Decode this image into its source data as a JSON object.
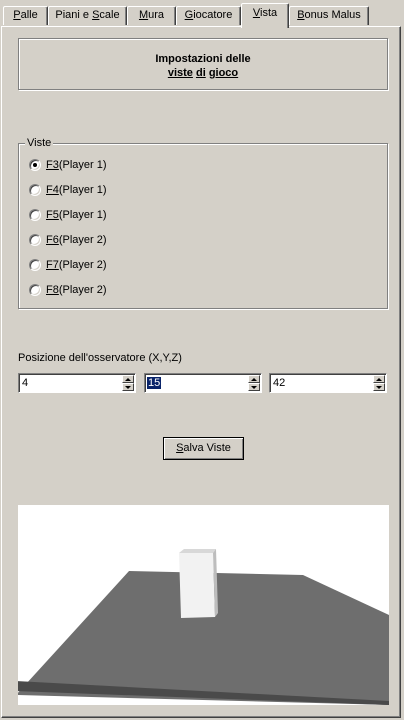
{
  "tabs": [
    {
      "pre": "",
      "key": "P",
      "post": "alle"
    },
    {
      "pre": "Piani e ",
      "key": "S",
      "post": "cale"
    },
    {
      "pre": "",
      "key": "M",
      "post": "ura"
    },
    {
      "pre": "",
      "key": "G",
      "post": "iocatore"
    },
    {
      "pre": "",
      "key": "V",
      "post": "ista"
    },
    {
      "pre": "",
      "key": "B",
      "post": "onus Malus"
    }
  ],
  "active_tab": "Vista",
  "header": {
    "line1": "Impostazioni delle",
    "w1": "viste",
    "w2": "di",
    "w3": "gioco"
  },
  "views_group": {
    "legend": "Viste",
    "options": [
      {
        "key": "F3",
        "player": " (Player 1)",
        "checked": true
      },
      {
        "key": "F4",
        "player": " (Player 1)",
        "checked": false
      },
      {
        "key": "F5",
        "player": " (Player 1)",
        "checked": false
      },
      {
        "key": "F6",
        "player": " (Player 2)",
        "checked": false
      },
      {
        "key": "F7",
        "player": " (Player 2)",
        "checked": false
      },
      {
        "key": "F8",
        "player": " (Player 2)",
        "checked": false
      }
    ]
  },
  "observer": {
    "label": "Posizione dell'osservatore (X,Y,Z)",
    "x": "4",
    "y": "15",
    "z": "42"
  },
  "save_button": {
    "key": "S",
    "post": "alva Viste"
  }
}
